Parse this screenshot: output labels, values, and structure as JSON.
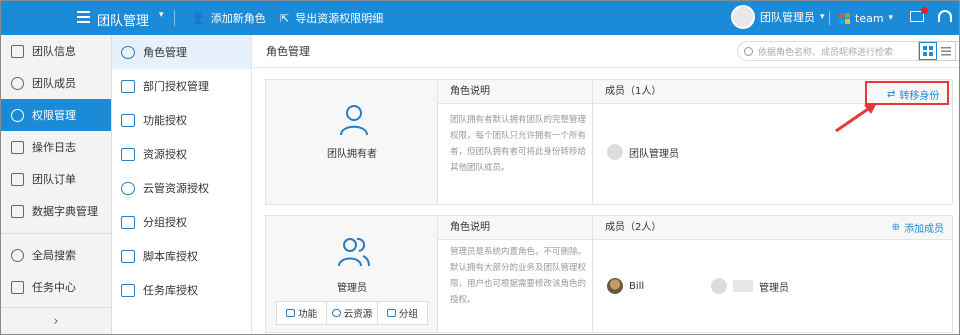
{
  "topbar": {
    "title": "团队管理",
    "add_role": "添加新角色",
    "export": "导出资源权限明细",
    "user": "团队管理员",
    "team": "team"
  },
  "leftnav": {
    "items": [
      {
        "label": "团队信息"
      },
      {
        "label": "团队成员"
      },
      {
        "label": "权限管理",
        "active": true
      },
      {
        "label": "操作日志"
      },
      {
        "label": "团队订单"
      },
      {
        "label": "数据字典管理"
      },
      {
        "label": "全局搜索"
      },
      {
        "label": "任务中心"
      }
    ]
  },
  "subnav": {
    "items": [
      {
        "label": "角色管理",
        "active": true
      },
      {
        "label": "部门授权管理"
      },
      {
        "label": "功能授权"
      },
      {
        "label": "资源授权"
      },
      {
        "label": "云管资源授权"
      },
      {
        "label": "分组授权"
      },
      {
        "label": "脚本库授权"
      },
      {
        "label": "任务库授权"
      }
    ]
  },
  "main": {
    "title": "角色管理",
    "search_placeholder": "依据角色名称、成员昵称进行检索"
  },
  "roles": [
    {
      "name": "团队拥有者",
      "desc_head": "角色说明",
      "desc": "团队拥有者默认拥有团队的完整管理权限，每个团队只允许拥有一个所有者，但团队拥有者可将此身份转移给其他团队成员。",
      "members_head": "成员（1人）",
      "action": "转移身份",
      "members": [
        "团队管理员"
      ]
    },
    {
      "name": "管理员",
      "desc_head": "角色说明",
      "desc": "管理员是系统内置角色，不可删除。默认拥有大部分的业务及团队管理权限，用户也可根据需要修改该角色的授权。",
      "members_head": "成员（2人）",
      "action": "添加成员",
      "members": [
        "Bill",
        "管理员"
      ],
      "buttons": [
        "功能",
        "云资源",
        "分组"
      ]
    }
  ],
  "colors": {
    "brand": "#1b8bd7",
    "highlight": "#e53935"
  }
}
